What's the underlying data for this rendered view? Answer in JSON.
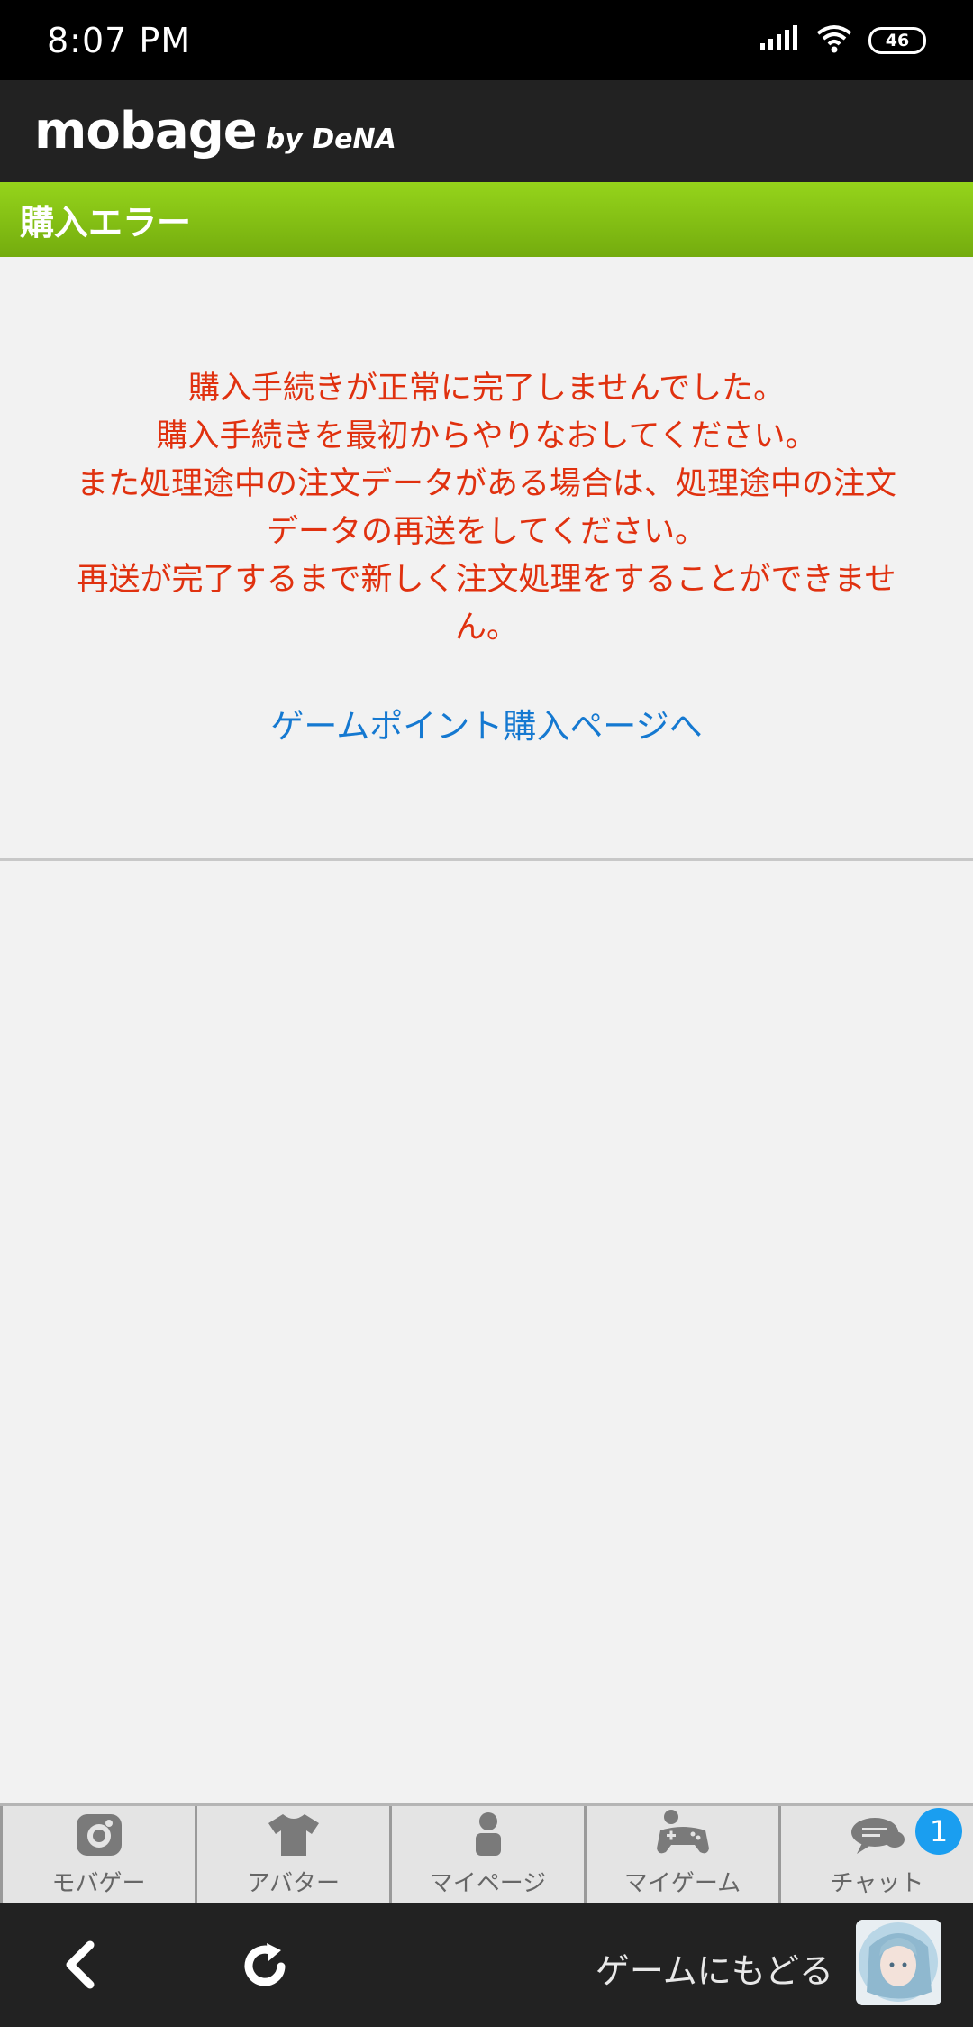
{
  "status_bar": {
    "time": "8:07 PM",
    "battery": "46"
  },
  "header": {
    "logo_main": "mobage",
    "logo_sub": "by DeNA"
  },
  "page_title": "購入エラー",
  "error_message": {
    "lines": [
      "購入手続きが正常に完了しませんでした。",
      "購入手続きを最初からやりなおしてください。",
      "また処理途中の注文データがある場合は、処理途中の注文",
      "データの再送をしてください。",
      "再送が完了するまで新しく注文処理をすることができませ",
      "ん。"
    ]
  },
  "purchase_link": "ゲームポイント購入ページへ",
  "bottom_nav": {
    "items": [
      {
        "label": "モバゲー",
        "icon": "mobage-icon"
      },
      {
        "label": "アバター",
        "icon": "tshirt-icon"
      },
      {
        "label": "マイページ",
        "icon": "person-icon"
      },
      {
        "label": "マイゲーム",
        "icon": "gamepad-icon"
      },
      {
        "label": "チャット",
        "icon": "chat-icon",
        "badge": "1"
      }
    ]
  },
  "footer": {
    "return_label": "ゲームにもどる"
  },
  "colors": {
    "title_bar": "#85c214",
    "error_text": "#e0310f",
    "link": "#1579d1",
    "badge": "#1a9ef0"
  }
}
